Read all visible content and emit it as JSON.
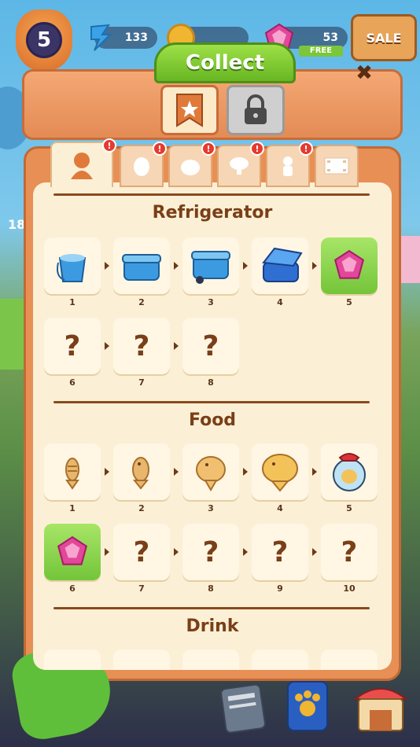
{
  "hud": {
    "level": "5",
    "energy": "133",
    "gems": "53",
    "gems_tag": "FREE",
    "sale_label": "SALE",
    "side_number": "18"
  },
  "header": {
    "title": "Collect",
    "close_label": "✖"
  },
  "tabs": [
    {
      "name": "tab-chef",
      "badge": "!",
      "active": true
    },
    {
      "name": "tab-ingredient",
      "badge": "!",
      "active": false
    },
    {
      "name": "tab-cat",
      "badge": "!",
      "active": false
    },
    {
      "name": "tab-bubble",
      "badge": "!",
      "active": false
    },
    {
      "name": "tab-cook",
      "badge": "!",
      "active": false
    },
    {
      "name": "tab-film",
      "badge": "",
      "active": false
    }
  ],
  "sections": {
    "refrigerator": {
      "title": "Refrigerator",
      "items": [
        {
          "num": "1",
          "icon": "bucket-icon"
        },
        {
          "num": "2",
          "icon": "cooler-box-icon"
        },
        {
          "num": "3",
          "icon": "wheeled-cooler-icon"
        },
        {
          "num": "4",
          "icon": "open-cooler-icon"
        },
        {
          "num": "5",
          "icon": "gem-icon"
        },
        {
          "num": "6",
          "icon": "unknown-icon",
          "label": "?"
        },
        {
          "num": "7",
          "icon": "unknown-icon",
          "label": "?"
        },
        {
          "num": "8",
          "icon": "unknown-icon",
          "label": "?"
        }
      ]
    },
    "food": {
      "title": "Food",
      "items": [
        {
          "num": "1",
          "icon": "fish-bone-cookie-icon"
        },
        {
          "num": "2",
          "icon": "fish-cookie-icon"
        },
        {
          "num": "3",
          "icon": "taiyaki-icon"
        },
        {
          "num": "4",
          "icon": "taiyaki-bun-icon"
        },
        {
          "num": "5",
          "icon": "cookie-jar-icon"
        },
        {
          "num": "6",
          "icon": "gem-icon"
        },
        {
          "num": "7",
          "icon": "unknown-icon",
          "label": "?"
        },
        {
          "num": "8",
          "icon": "unknown-icon",
          "label": "?"
        },
        {
          "num": "9",
          "icon": "unknown-icon",
          "label": "?"
        },
        {
          "num": "10",
          "icon": "unknown-icon",
          "label": "?"
        }
      ]
    },
    "drink": {
      "title": "Drink"
    }
  },
  "colors": {
    "accent_green": "#7bc63b",
    "panel_orange": "#e88f55",
    "content_cream": "#fbf0d6",
    "title_brown": "#7a3f18"
  }
}
